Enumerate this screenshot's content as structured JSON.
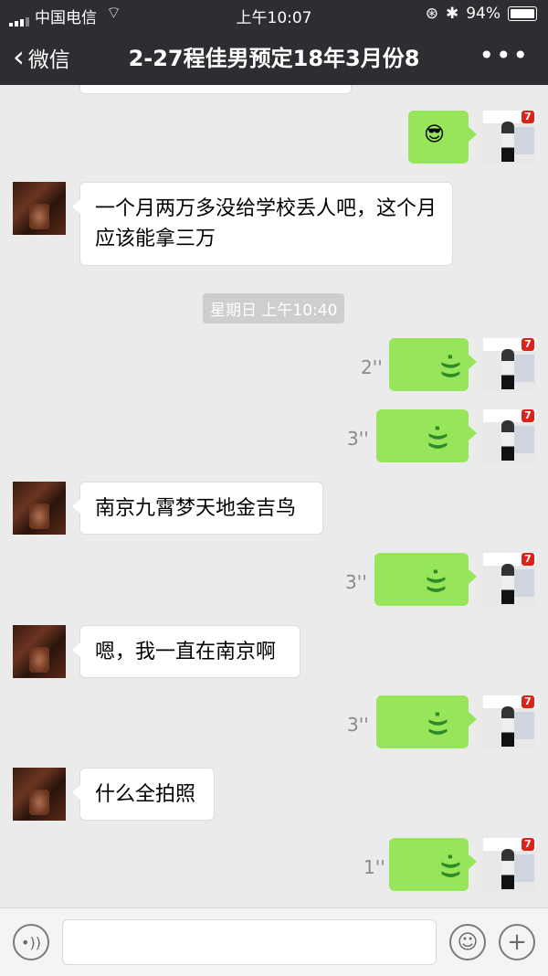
{
  "status": {
    "carrier": "中国电信",
    "time": "上午10:07",
    "battery": "94%"
  },
  "header": {
    "back_label": "微信",
    "title": "2-27程佳男预定18年3月份8",
    "more_label": "•••"
  },
  "messages": [
    {
      "type": "emoji",
      "side": "right",
      "emoji": "😎"
    },
    {
      "type": "text",
      "side": "left",
      "text": "一个月两万多没给学校丢人吧，这个月应该能拿三万"
    },
    {
      "type": "timestamp",
      "text": "星期日 上午10:40"
    },
    {
      "type": "voice",
      "side": "right",
      "duration": "2''"
    },
    {
      "type": "voice",
      "side": "right",
      "duration": "3''"
    },
    {
      "type": "text",
      "side": "left",
      "text": "南京九霄梦天地金吉鸟"
    },
    {
      "type": "voice",
      "side": "right",
      "duration": "3''"
    },
    {
      "type": "text",
      "side": "left",
      "text": "嗯，我一直在南京啊"
    },
    {
      "type": "voice",
      "side": "right",
      "duration": "3''"
    },
    {
      "type": "text",
      "side": "left",
      "text": "什么全拍照"
    },
    {
      "type": "voice",
      "side": "right",
      "duration": "1''"
    }
  ],
  "icons": {
    "voice_wave": "((·",
    "voice_toggle": "sound-wave-icon",
    "emoji": "smiley-icon",
    "plus": "plus-icon"
  },
  "colors": {
    "header_bg": "#2e2e32",
    "bubble_right": "#97e55a",
    "chat_bg": "#ebebeb"
  }
}
